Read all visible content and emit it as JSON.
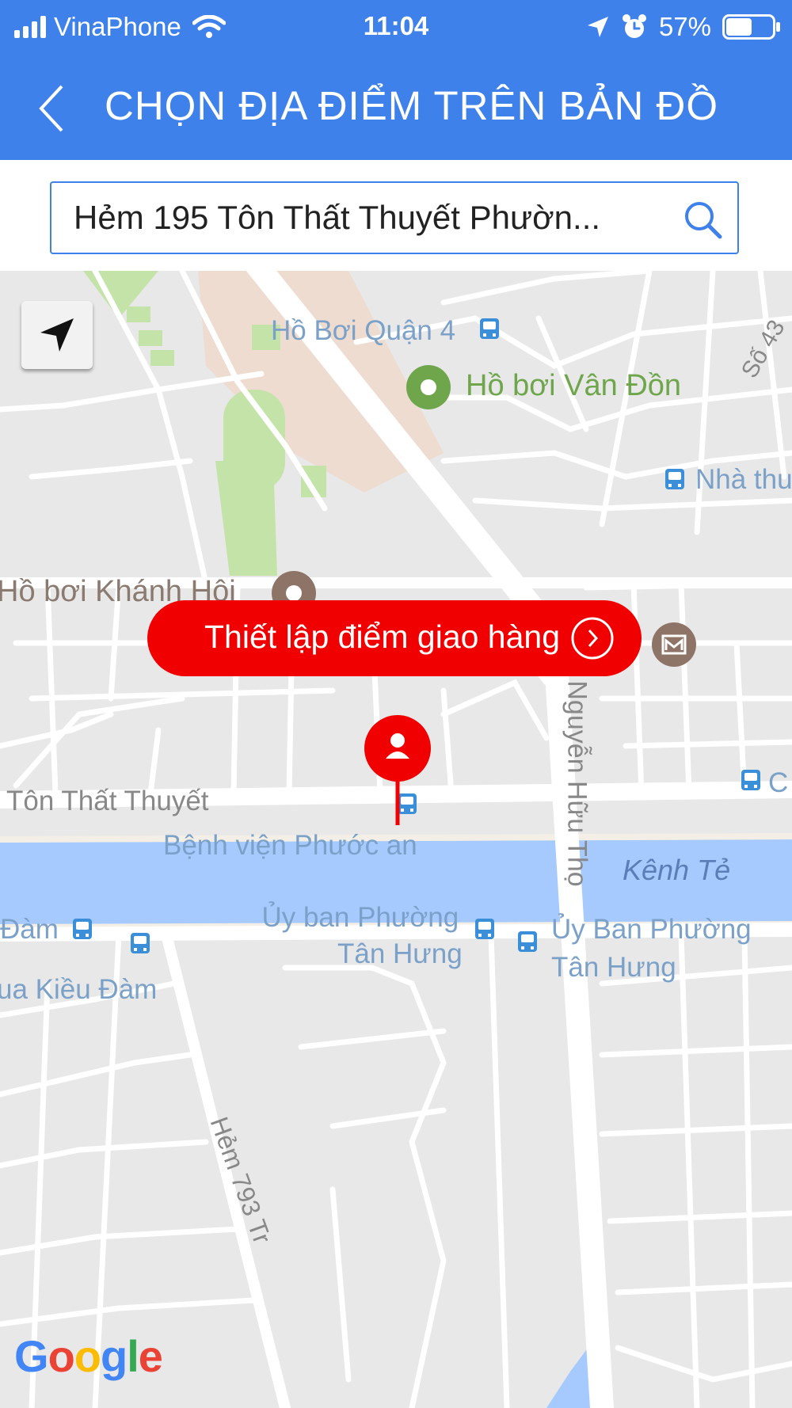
{
  "status_bar": {
    "carrier": "VinaPhone",
    "time": "11:04",
    "battery_percent": "57%",
    "battery_level": 0.57,
    "icons": [
      "signal-icon",
      "wifi-icon",
      "location-arrow-icon",
      "alarm-icon",
      "battery-icon"
    ]
  },
  "nav": {
    "title": "CHỌN ĐỊA ĐIỂM TRÊN BẢN ĐỒ",
    "back_icon": "chevron-left-icon"
  },
  "search": {
    "value": "Hẻm 195 Tôn Thất Thuyết Phườn...",
    "icon": "search-icon"
  },
  "map": {
    "labels": {
      "pool_district4": "Hồ Bơi Quận 4",
      "pool_van_don": "Hồ bơi Vân Đồn",
      "so43": "Số 43",
      "nha_thu": "Nhà thu",
      "pool_khanh_hoi": "Hồ bơi Khánh Hội",
      "nguyen_huu_tho": "Nguyễn Hữu Thọ",
      "c_edge": "C",
      "ton_that_thuyet": "Tôn Thất Thuyết",
      "benh_vien": "Bệnh viện Phước an",
      "kenh_te": "Kênh Tẻ",
      "ubnd_tan_hung_left": [
        "Ủy ban Phường",
        "Tân Hưng"
      ],
      "ubnd_tan_hung_right": [
        "Ủy Ban Phường",
        "Tân Hưng"
      ],
      "dam": "Đàm",
      "kieu_dam": "ua Kiều Đàm",
      "hem_793": "Hẻm 793 Tr"
    },
    "delivery_button": "Thiết lập điểm giao hàng",
    "google": [
      "G",
      "o",
      "o",
      "g",
      "l",
      "e"
    ],
    "colors": {
      "road": "#ffffff",
      "land": "#e8e8e8",
      "water": "#a6cafe",
      "park": "#c4e3a8",
      "commercial": "#eddccf",
      "accent": "#3f81ea",
      "pin": "#f00000"
    }
  }
}
